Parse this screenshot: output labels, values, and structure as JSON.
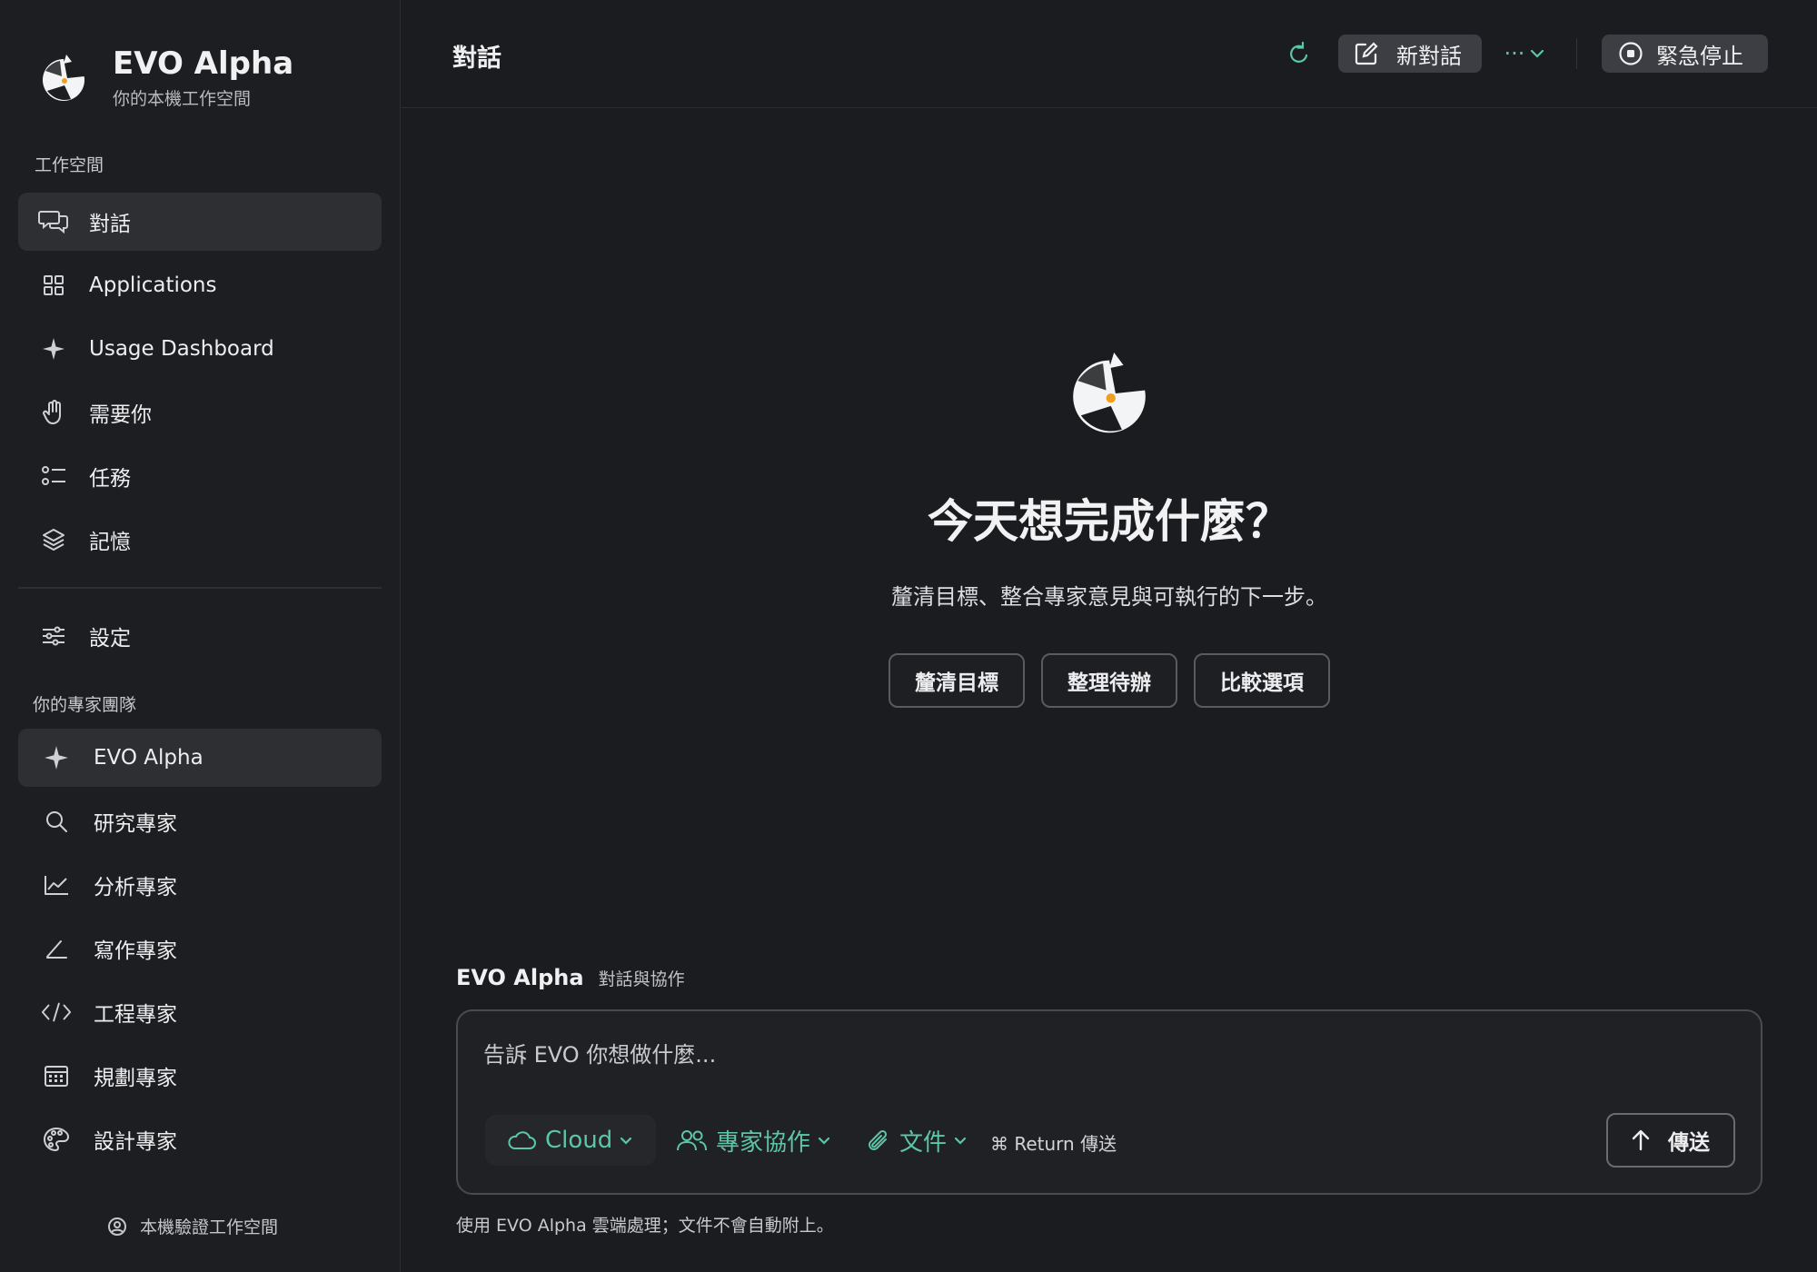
{
  "brand": {
    "name": "EVO Alpha",
    "subtitle": "你的本機工作空間"
  },
  "sidebar": {
    "workspace_label": "工作空間",
    "items": [
      {
        "label": "對話",
        "icon": "chat-bubbles-icon",
        "active": true
      },
      {
        "label": "Applications",
        "icon": "grid-icon",
        "active": false
      },
      {
        "label": "Usage Dashboard",
        "icon": "sparkle-icon",
        "active": false
      },
      {
        "label": "需要你",
        "icon": "hand-icon",
        "active": false
      },
      {
        "label": "任務",
        "icon": "checklist-icon",
        "active": false
      },
      {
        "label": "記憶",
        "icon": "layers-icon",
        "active": false
      }
    ],
    "settings_label": "設定",
    "team_label": "你的專家團隊",
    "team": [
      {
        "label": "EVO Alpha",
        "icon": "sparkle-icon",
        "active": true
      },
      {
        "label": "研究專家",
        "icon": "search-icon",
        "active": false
      },
      {
        "label": "分析專家",
        "icon": "line-chart-icon",
        "active": false
      },
      {
        "label": "寫作專家",
        "icon": "pen-icon",
        "active": false
      },
      {
        "label": "工程專家",
        "icon": "code-icon",
        "active": false
      },
      {
        "label": "規劃專家",
        "icon": "calendar-icon",
        "active": false
      },
      {
        "label": "設計專家",
        "icon": "palette-icon",
        "active": false
      }
    ],
    "footer": "本機驗證工作空間"
  },
  "header": {
    "title": "對話",
    "new_chat": "新對話",
    "more": "···",
    "stop": "緊急停止"
  },
  "hero": {
    "title": "今天想完成什麼？",
    "subtitle": "釐清目標、整合專家意見與可執行的下一步。",
    "chips": [
      "釐清目標",
      "整理待辦",
      "比較選項"
    ]
  },
  "composer": {
    "name": "EVO Alpha",
    "tag": "對話與協作",
    "placeholder": "告訴 EVO 你想做什麼...",
    "model": "Cloud",
    "team": "專家協作",
    "docs": "文件",
    "hint": "⌘ Return 傳送",
    "send": "傳送",
    "note": "使用 EVO Alpha 雲端處理；文件不會自動附上。"
  },
  "colors": {
    "accent": "#5cc6a8",
    "background": "#1b1c1f",
    "surface": "#2e2f33"
  }
}
